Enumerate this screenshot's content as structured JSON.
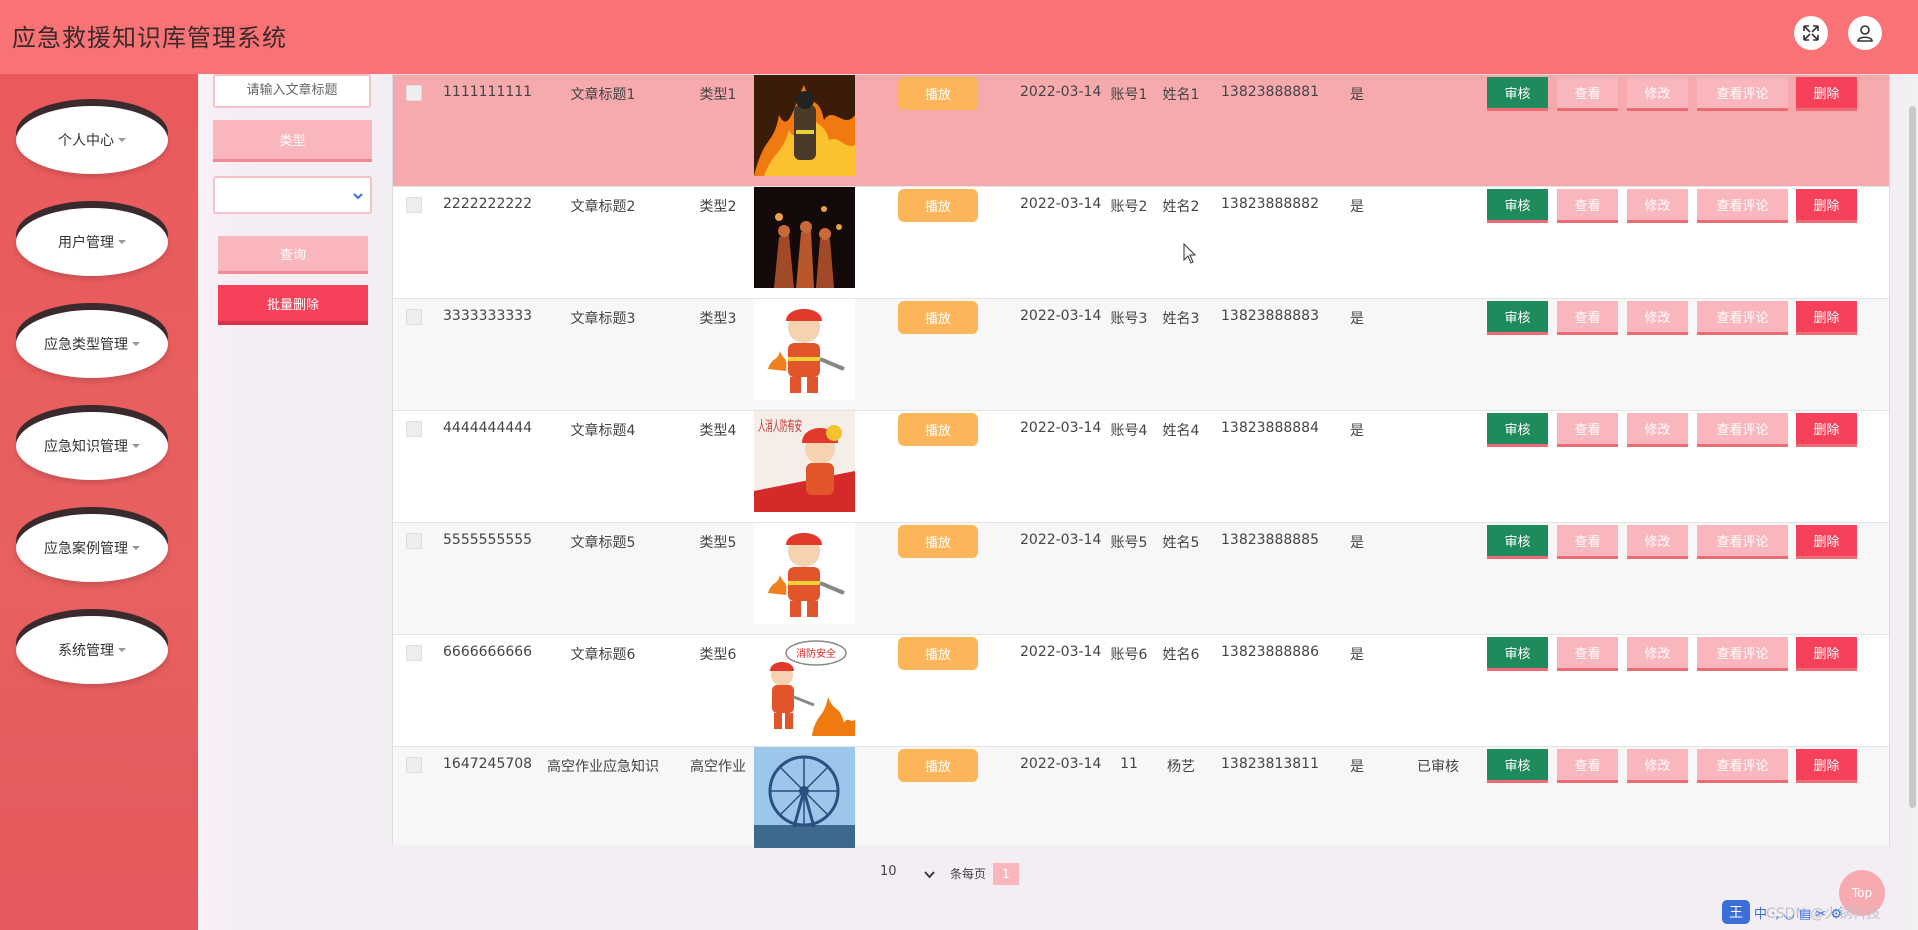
{
  "header": {
    "title": "应急救援知识库管理系统",
    "fullscreen_icon": "expand-icon",
    "user_icon": "user-icon"
  },
  "sidebar": {
    "items": [
      {
        "label": "个人中心"
      },
      {
        "label": "用户管理"
      },
      {
        "label": "应急类型管理"
      },
      {
        "label": "应急知识管理"
      },
      {
        "label": "应急案例管理"
      },
      {
        "label": "系统管理"
      }
    ]
  },
  "filter": {
    "title_placeholder": "请输入文章标题",
    "type_label": "类型",
    "type_select_value": "",
    "query_label": "查询",
    "batch_delete_label": "批量删除"
  },
  "table": {
    "play_label": "播放",
    "actions": {
      "audit": "审核",
      "view": "查看",
      "edit": "修改",
      "comments": "查看评论",
      "delete": "删除"
    },
    "rows": [
      {
        "id": "1111111111",
        "title": "文章标题1",
        "type": "类型1",
        "thumb": "fire-scene",
        "date": "2022-03-14",
        "account": "账号1",
        "name": "姓名1",
        "phone": "13823888881",
        "flag": "是",
        "status": ""
      },
      {
        "id": "2222222222",
        "title": "文章标题2",
        "type": "类型2",
        "thumb": "firefighters-night",
        "date": "2022-03-14",
        "account": "账号2",
        "name": "姓名2",
        "phone": "13823888882",
        "flag": "是",
        "status": ""
      },
      {
        "id": "3333333333",
        "title": "文章标题3",
        "type": "类型3",
        "thumb": "cartoon-firefighter",
        "date": "2022-03-14",
        "account": "账号3",
        "name": "姓名3",
        "phone": "13823888883",
        "flag": "是",
        "status": ""
      },
      {
        "id": "4444444444",
        "title": "文章标题4",
        "type": "类型4",
        "thumb": "fire-safety-poster",
        "date": "2022-03-14",
        "account": "账号4",
        "name": "姓名4",
        "phone": "13823888884",
        "flag": "是",
        "status": ""
      },
      {
        "id": "5555555555",
        "title": "文章标题5",
        "type": "类型5",
        "thumb": "cartoon-firefighter",
        "date": "2022-03-14",
        "account": "账号5",
        "name": "姓名5",
        "phone": "13823888885",
        "flag": "是",
        "status": ""
      },
      {
        "id": "6666666666",
        "title": "文章标题6",
        "type": "类型6",
        "thumb": "cartoon-fire-hose",
        "date": "2022-03-14",
        "account": "账号6",
        "name": "姓名6",
        "phone": "13823888886",
        "flag": "是",
        "status": ""
      },
      {
        "id": "1647245708",
        "title": "高空作业应急知识",
        "type": "高空作业",
        "thumb": "ferris-wheel",
        "date": "2022-03-14",
        "account": "11",
        "name": "杨艺",
        "phone": "13823813811",
        "flag": "是",
        "status": "已审核"
      }
    ]
  },
  "poster_text": "人消人防有安",
  "cartoon_banner": "消防安全",
  "pagination": {
    "page_size": "10",
    "per_page_label": "条每页",
    "current_page": "1"
  },
  "top_button_label": "Top",
  "watermark": "CSDN @火锅科技",
  "ime": {
    "logo": "王",
    "text": "中 ·, ◡ ▤ ✂ ⚙"
  },
  "colors": {
    "header_bg": "#f97275",
    "sidebar_bg": "#ea5a5d",
    "highlight_row": "#f7aaae",
    "audit_green": "#1f8a5c",
    "pink_button": "#f9b7bd",
    "delete_red": "#f7415b",
    "play_orange": "#fdb559"
  }
}
